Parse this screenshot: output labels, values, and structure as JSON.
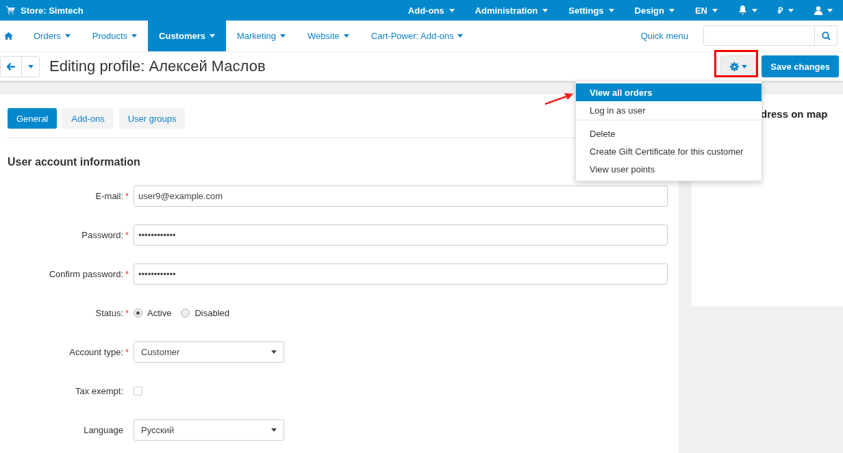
{
  "top_bar": {
    "store_label": "Store: Simtech",
    "items": [
      {
        "kind": "text",
        "label": "Add-ons"
      },
      {
        "kind": "text",
        "label": "Administration"
      },
      {
        "kind": "text",
        "label": "Settings"
      },
      {
        "kind": "text",
        "label": "Design"
      },
      {
        "kind": "text",
        "label": "EN"
      },
      {
        "kind": "bell"
      },
      {
        "kind": "text",
        "label": "₽"
      },
      {
        "kind": "user"
      }
    ]
  },
  "nav": {
    "items": [
      {
        "label": "Orders",
        "selected": false
      },
      {
        "label": "Products",
        "selected": false
      },
      {
        "label": "Customers",
        "selected": true
      },
      {
        "label": "Marketing",
        "selected": false
      },
      {
        "label": "Website",
        "selected": false
      },
      {
        "label": "Cart-Power: Add-ons",
        "selected": false
      }
    ],
    "quick_menu": "Quick menu"
  },
  "toolbar": {
    "title": "Editing profile: Алексей Маслов",
    "save_button": "Save changes",
    "menu": [
      {
        "label": "View all orders",
        "selected": true,
        "divider_before": false
      },
      {
        "label": "Log in as user",
        "selected": false,
        "divider_before": false
      },
      {
        "label": "Delete",
        "selected": false,
        "divider_before": true
      },
      {
        "label": "Create Gift Certificate for this customer",
        "selected": false,
        "divider_before": false
      },
      {
        "label": "View user points",
        "selected": false,
        "divider_before": false
      }
    ]
  },
  "tabs": [
    {
      "label": "General",
      "selected": true
    },
    {
      "label": "Add-ons",
      "selected": false
    },
    {
      "label": "User groups",
      "selected": false
    }
  ],
  "section_title": "User account information",
  "fields": [
    {
      "kind": "text",
      "label": "E-mail:",
      "required_mark": "*",
      "value": "user9@example.com"
    },
    {
      "kind": "text",
      "label": "Password:",
      "required_mark": "*",
      "value": "••••••••••••"
    },
    {
      "kind": "text",
      "label": "Confirm password:",
      "required_mark": "*",
      "value": "••••••••••••"
    },
    {
      "kind": "radio",
      "label": "Status:",
      "required_mark": "*",
      "options": [
        {
          "label": "Active",
          "selected": true
        },
        {
          "label": "Disabled",
          "selected": false
        }
      ]
    },
    {
      "kind": "select",
      "label": "Account type:",
      "required_mark": "*",
      "value": "Customer"
    },
    {
      "kind": "checkbox",
      "label": "Tax exempt:",
      "checked": false
    },
    {
      "kind": "select",
      "label": "Language",
      "value": "Русский"
    }
  ],
  "sidebar": {
    "card_title": "dress on map"
  }
}
